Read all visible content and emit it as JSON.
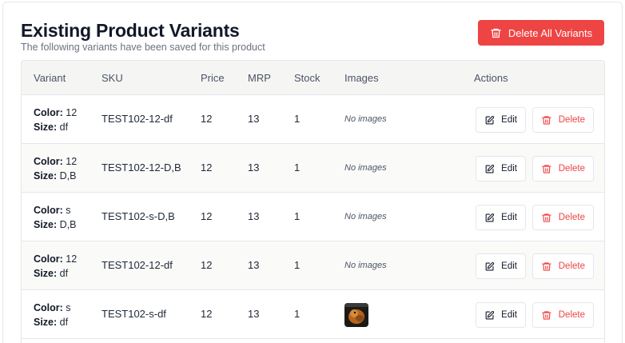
{
  "header": {
    "title": "Existing Product Variants",
    "subtitle": "The following variants have been saved for this product",
    "delete_all_label": "Delete All Variants"
  },
  "table": {
    "columns": [
      "Variant",
      "SKU",
      "Price",
      "MRP",
      "Stock",
      "Images",
      "Actions"
    ],
    "color_label": "Color:",
    "size_label": "Size:",
    "edit_label": "Edit",
    "delete_label": "Delete",
    "no_images_label": "No images",
    "rows": [
      {
        "color": "12",
        "size": "df",
        "sku": "TEST102-12-df",
        "price": "12",
        "mrp": "13",
        "stock": "1",
        "has_image": false
      },
      {
        "color": "12",
        "size": "D,B",
        "sku": "TEST102-12-D,B",
        "price": "12",
        "mrp": "13",
        "stock": "1",
        "has_image": false
      },
      {
        "color": "s",
        "size": "D,B",
        "sku": "TEST102-s-D,B",
        "price": "12",
        "mrp": "13",
        "stock": "1",
        "has_image": false
      },
      {
        "color": "12",
        "size": "df",
        "sku": "TEST102-12-df",
        "price": "12",
        "mrp": "13",
        "stock": "1",
        "has_image": false
      },
      {
        "color": "s",
        "size": "df",
        "sku": "TEST102-s-df",
        "price": "12",
        "mrp": "13",
        "stock": "1",
        "has_image": true
      }
    ]
  },
  "colors": {
    "danger": "#ef4444",
    "header_bg": "#f5f5f4",
    "border": "#e5e7eb"
  },
  "icons": {
    "delete_all": "trash-icon",
    "edit": "edit-square-pen-icon",
    "delete": "trash-icon"
  }
}
